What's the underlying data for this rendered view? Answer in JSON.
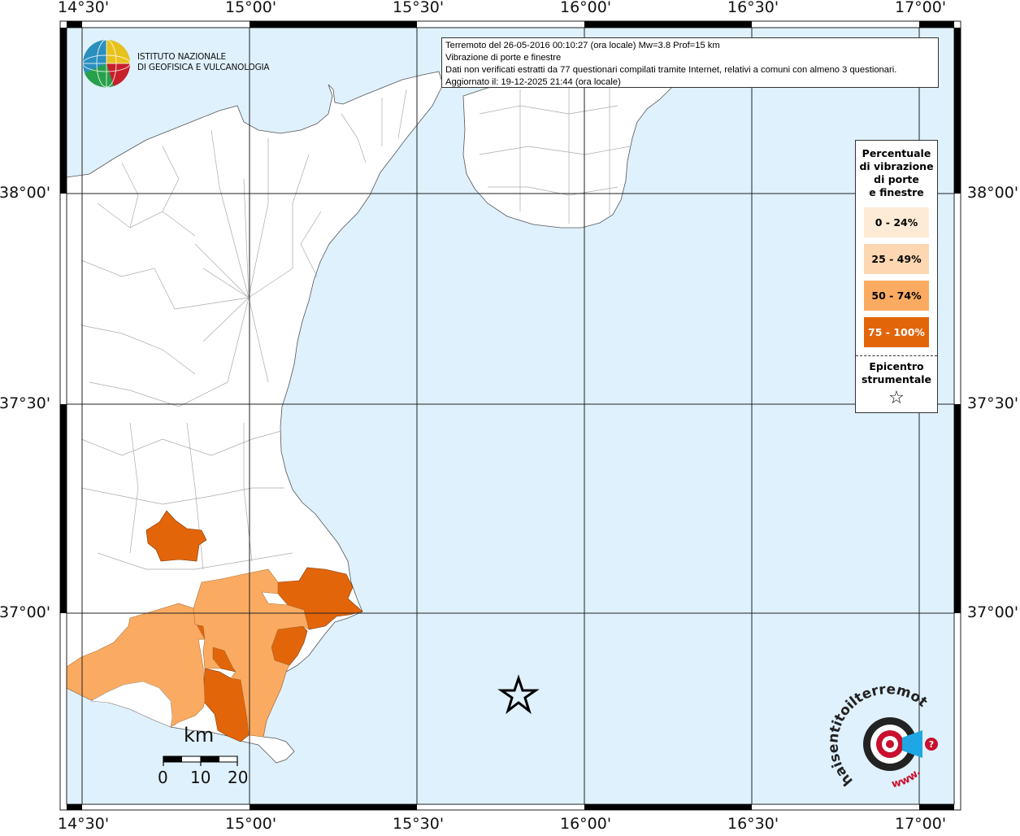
{
  "info": {
    "line1": "Terremoto del 26-05-2016 00:10:27 (ora locale) Mw=3.8 Prof=15 km",
    "line2": "Vibrazione di porte e finestre",
    "line3": "Dati non verificati estratti da 77 questionari compilati tramite Internet, relativi a comuni con almeno 3 questionari.",
    "line4": "Aggiornato il: 19-12-2025 21:44 (ora locale)"
  },
  "institute": {
    "name_line1": "ISTITUTO NAZIONALE",
    "name_line2": "DI GEOFISICA E VULCANOLOGIA"
  },
  "legend": {
    "title_lines": [
      "Percentuale",
      "di vibrazione",
      "di porte",
      "e finestre"
    ],
    "classes": [
      {
        "label": "0 - 24%",
        "color": "#fdebd5",
        "text_color": "#000000"
      },
      {
        "label": "25 - 49%",
        "color": "#fdd7b1",
        "text_color": "#000000"
      },
      {
        "label": "50 - 74%",
        "color": "#fbab61",
        "text_color": "#000000"
      },
      {
        "label": "75 - 100%",
        "color": "#e3650a",
        "text_color": "#ffffff"
      }
    ],
    "epicenter_lines": [
      "Epicentro",
      "strumentale"
    ],
    "epicenter_symbol": "☆"
  },
  "axes": {
    "lon_labels": [
      "14°30'",
      "15°00'",
      "15°30'",
      "16°00'",
      "16°30'",
      "17°00'"
    ],
    "lat_labels": [
      "38°00'",
      "37°30'",
      "37°00'"
    ]
  },
  "scale_bar": {
    "unit": "km",
    "ticks": [
      "0",
      "10",
      "20"
    ]
  },
  "colors": {
    "sea": "#dff1fd",
    "land": "#ffffff",
    "border": "#999999",
    "grid": "#222222",
    "class_50_74": "#fbab61",
    "class_75_100": "#e3650a"
  },
  "watermark": {
    "text": "haisentitoilterremoto.it",
    "prefix": "www."
  }
}
